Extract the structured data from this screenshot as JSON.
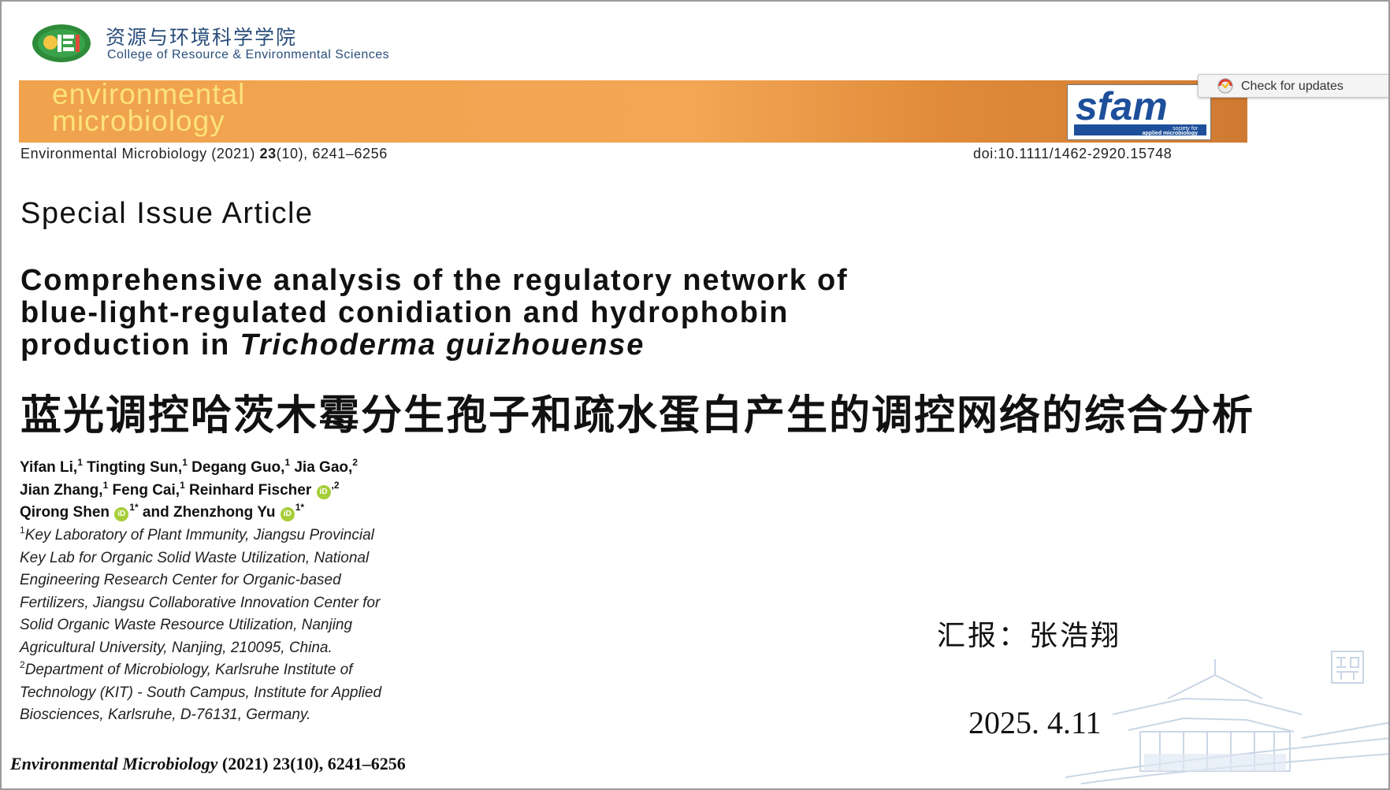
{
  "header": {
    "college_cn": "资源与环境科学学院",
    "college_en": "College of Resource & Environmental Sciences"
  },
  "check_updates": "Check for updates",
  "journal": {
    "banner_line1": "environmental",
    "banner_line2": "microbiology",
    "sfam_logo": "sfam",
    "sfam_sub1": "society for",
    "sfam_sub2": "applied microbiology",
    "citation_prefix": "Environmental Microbiology (2021) ",
    "citation_volume": "23",
    "citation_suffix": "(10), 6241–6256",
    "doi": "doi:10.1111/1462-2920.15748"
  },
  "article": {
    "type": "Special Issue Article",
    "title_line1": "Comprehensive analysis of the regulatory network of",
    "title_line2": "blue-light-regulated conidiation and hydrophobin",
    "title_line3_prefix": "production in ",
    "title_line3_species": "Trichoderma guizhouense",
    "title_cn": "蓝光调控哈茨木霉分生孢子和疏水蛋白产生的调控网络的综合分析"
  },
  "authors": [
    {
      "name": "Yifan Li,",
      "aff": "1"
    },
    {
      "name": "Tingting Sun,",
      "aff": "1"
    },
    {
      "name": "Degang Guo,",
      "aff": "1"
    },
    {
      "name": "Jia Gao,",
      "aff": "2"
    },
    {
      "name": "Jian Zhang,",
      "aff": "1"
    },
    {
      "name": "Feng Cai,",
      "aff": "1"
    },
    {
      "name": "Reinhard Fischer",
      "aff": ",2"
    },
    {
      "name": "Qirong Shen",
      "aff": "1*"
    },
    {
      "name": "and Zhenzhong Yu",
      "aff": "1*"
    }
  ],
  "affiliations": [
    {
      "sup": "1",
      "lines": [
        "Key Laboratory of Plant Immunity, Jiangsu Provincial",
        "Key Lab for Organic Solid Waste Utilization, National",
        "Engineering Research Center for Organic-based",
        "Fertilizers, Jiangsu Collaborative Innovation Center for",
        "Solid Organic Waste Resource Utilization, Nanjing",
        "Agricultural University, Nanjing, 210095, China."
      ]
    },
    {
      "sup": "2",
      "lines": [
        "Department of Microbiology, Karlsruhe Institute of",
        "Technology (KIT) - South Campus, Institute for Applied",
        "Biosciences, Karlsruhe, D-76131, Germany."
      ]
    }
  ],
  "bottom_citation": {
    "journal": "Environmental Microbiology",
    "rest": " (2021) 23(10), 6241–6256"
  },
  "reporter": "汇报：张浩翔",
  "date": "2025. 4.11",
  "colors": {
    "banner_orange": "#f0a24c",
    "banner_text": "#fce27a",
    "college_blue": "#2a4e7a",
    "sfam_blue": "#1d4f9b",
    "orcid_green": "#a6ce39"
  }
}
